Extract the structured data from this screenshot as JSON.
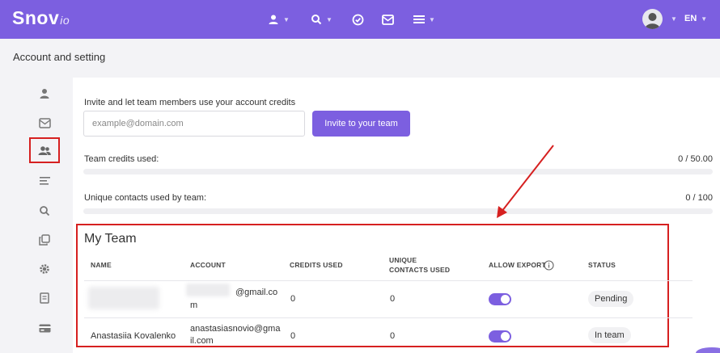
{
  "brand": {
    "name": "Snov",
    "suffix": "io",
    "accent": "#7c5fe0"
  },
  "topnav": {
    "items": [
      {
        "icon": "user-icon",
        "has_caret": true
      },
      {
        "icon": "search-icon",
        "has_caret": true
      },
      {
        "icon": "check-circle-icon",
        "has_caret": false
      },
      {
        "icon": "mail-icon",
        "has_caret": false
      },
      {
        "icon": "menu-icon",
        "has_caret": true
      }
    ],
    "language": "EN"
  },
  "page": {
    "title": "Account and setting"
  },
  "sidebar": {
    "items": [
      {
        "icon": "user-icon",
        "active": false
      },
      {
        "icon": "mail-icon",
        "active": false
      },
      {
        "icon": "team-icon",
        "active": true
      },
      {
        "icon": "list-icon",
        "active": false
      },
      {
        "icon": "search-icon",
        "active": false
      },
      {
        "icon": "copy-icon",
        "active": false
      },
      {
        "icon": "gear-icon",
        "active": false
      },
      {
        "icon": "document-icon",
        "active": false
      },
      {
        "icon": "card-icon",
        "active": false
      }
    ]
  },
  "invite": {
    "label": "Invite and let team members use your account credits",
    "placeholder": "example@domain.com",
    "value": "",
    "button": "Invite to your team"
  },
  "usage": {
    "credits_label": "Team credits used:",
    "credits_value": "0 / 50.00",
    "credits_fraction": 0,
    "contacts_label": "Unique contacts used by team:",
    "contacts_value": "0 / 100",
    "contacts_fraction": 0
  },
  "team": {
    "title": "My Team",
    "columns": [
      "NAME",
      "ACCOUNT",
      "CREDITS USED",
      "UNIQUE\nCONTACTS USED",
      "ALLOW EXPORT",
      "STATUS"
    ],
    "rows": [
      {
        "name": "",
        "account_line1": "@gmail.co",
        "account_line2": "m",
        "credits": "0",
        "contacts": "0",
        "allow_export": true,
        "status": "Pending"
      },
      {
        "name": "Anastasiia Kovalenko",
        "account_line1": "anastasiasnovio@gma",
        "account_line2": "il.com",
        "credits": "0",
        "contacts": "0",
        "allow_export": true,
        "status": "In team"
      }
    ]
  }
}
